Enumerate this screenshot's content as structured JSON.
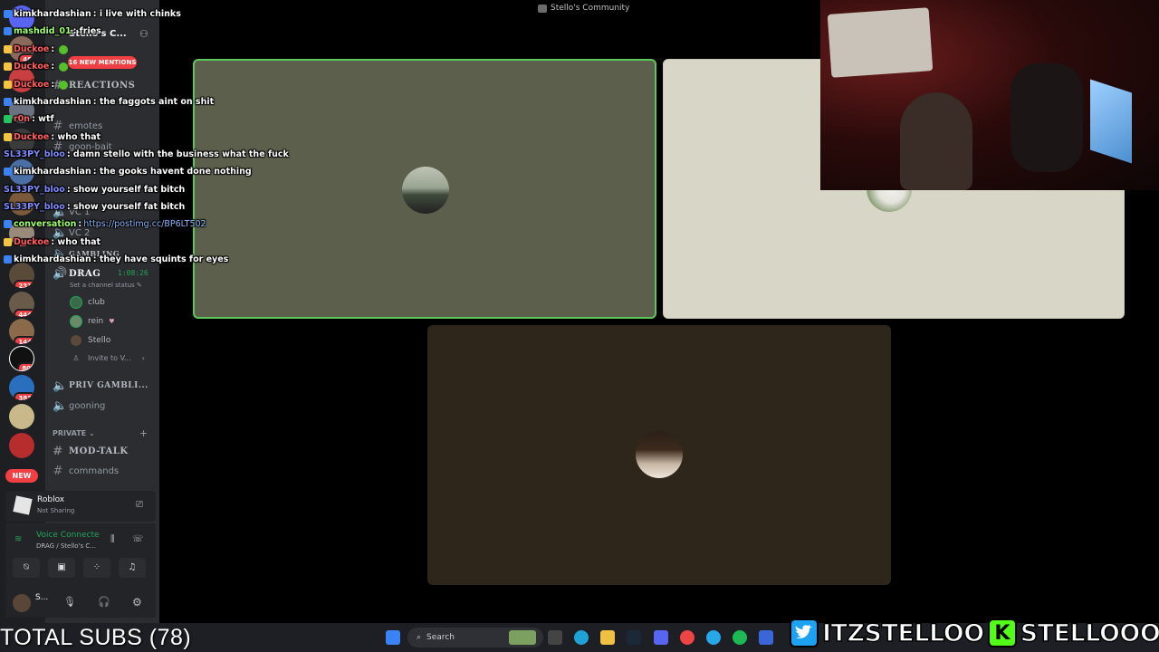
{
  "window": {
    "title": "Stello's Community"
  },
  "rail": {
    "badges": [
      "48",
      "16",
      "",
      "",
      "",
      "231",
      "444",
      "144",
      "80",
      "383"
    ],
    "new_label": "NEW"
  },
  "sidebar": {
    "server_name": "Stello's C...",
    "mentions_label": "16 NEW MENTIONS",
    "channels_top": [
      {
        "icon": "hash",
        "label": "REACTIONS",
        "bold": true
      },
      {
        "icon": "hash",
        "label": "emotes"
      },
      {
        "icon": "hash",
        "label": "goon-bait"
      },
      {
        "icon": "speaker",
        "label": "VC 1"
      },
      {
        "icon": "speaker",
        "label": "VC 2"
      },
      {
        "icon": "speaker",
        "label": "GAMBLING",
        "bold": true
      }
    ],
    "voice_channel": {
      "name": "DRAG",
      "timer": "1:08:26",
      "status_hint": "Set a channel status"
    },
    "voice_users": [
      "club",
      "rein",
      "Stello"
    ],
    "invite_label": "Invite to V...",
    "channels_bottom": [
      {
        "icon": "speaker",
        "label": "PRIV GAMBLI...",
        "bold": true
      },
      {
        "icon": "speaker",
        "label": "gooning"
      }
    ],
    "private_category": "PRIVATE",
    "private_channels": [
      {
        "icon": "hash",
        "label": "MOD-TALK",
        "bold": true
      },
      {
        "icon": "hash",
        "label": "commands"
      }
    ],
    "activity": {
      "title": "Roblox",
      "subtitle": "Not Sharing"
    },
    "voice_status": {
      "title": "Voice Connecte",
      "subtitle": "DRAG / Stello's C..."
    },
    "user": {
      "name": "S..."
    }
  },
  "chat": [
    {
      "user": "kimkhardashian",
      "color": "#ffffff",
      "text": ": i live with chinks",
      "ico": "#3b82f6"
    },
    {
      "user": "mashdid_01",
      "color": "#9cff6b",
      "text": ": fries",
      "ico": "#3b82f6"
    },
    {
      "user": "Duckoe",
      "color": "#ff5f5f",
      "text": ":",
      "ico": "#f5c542",
      "emote": true
    },
    {
      "user": "Duckoe",
      "color": "#ff5f5f",
      "text": ":",
      "ico": "#f5c542",
      "emote": true
    },
    {
      "user": "Duckoe",
      "color": "#ff5f5f",
      "text": ":",
      "ico": "#f5c542",
      "emote": true
    },
    {
      "user": "kimkhardashian",
      "color": "#ffffff",
      "text": ": the faggots aint on shit",
      "ico": "#3b82f6"
    },
    {
      "user": "r0n",
      "color": "#ff6060",
      "text": ": wtf",
      "ico": "#22c55e"
    },
    {
      "user": "Duckoe",
      "color": "#ff5f5f",
      "text": ": who that",
      "ico": "#f5c542"
    },
    {
      "user": "SL33PY_bloo",
      "color": "#7c8cff",
      "text": ": damn stello with the business what the fuck",
      "ico": ""
    },
    {
      "user": "kimkhardashian",
      "color": "#ffffff",
      "text": ": the gooks havent done nothing",
      "ico": "#3b82f6"
    },
    {
      "user": "SL33PY_bloo",
      "color": "#7c8cff",
      "text": ": show yourself fat bitch",
      "ico": ""
    },
    {
      "user": "SL33PY_bloo",
      "color": "#7c8cff",
      "text": ": show yourself fat bitch",
      "ico": ""
    },
    {
      "user": "conversation",
      "color": "#9cff6b",
      "text": ":",
      "link": "https://postimg.cc/BP6LT502",
      "ico": "#3b82f6"
    },
    {
      "user": "Duckoe",
      "color": "#ff5f5f",
      "text": ": who that",
      "ico": "#f5c542"
    },
    {
      "user": "kimkhardashian",
      "color": "#ffffff",
      "text": ": they have squints for eyes",
      "ico": "#3b82f6"
    }
  ],
  "taskbar": {
    "search_placeholder": "Search"
  },
  "overlay": {
    "subs_label": "TOTAL SUBS (78)",
    "twitter_handle": "ITZSTELLOO",
    "kick_handle": "STELLOOO",
    "kick_letter": "K"
  },
  "colors": {
    "tile1_bg": "#5c5f4b",
    "tile1_border": "#5ac85a",
    "tile2_bg": "#d8d7c7",
    "tile3_bg": "#2e261b",
    "discord_red": "#f23f43"
  }
}
